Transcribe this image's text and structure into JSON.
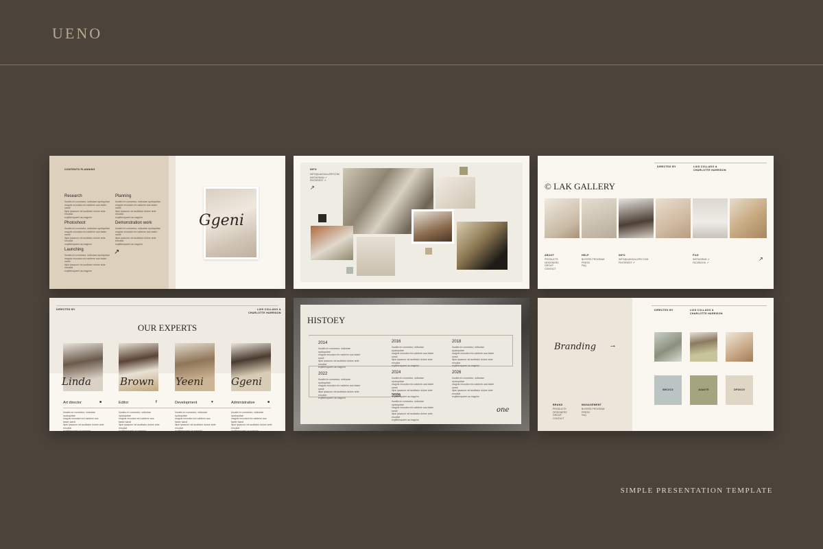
{
  "brand": "UENO",
  "tagline": "SIMPLE PRESENTATION TEMPLATE",
  "lorem": "Iluvalis im consectur, sidiuctae spoloquitae\nmagnis recustan etu vakterm aus faster sandi\nIlipsi ipsacum vel auditatur dolore ante errudtat\nexplitienqueet ua magnim",
  "slide1": {
    "header": "CONTENTS PLANNING",
    "items": [
      {
        "title": "Research"
      },
      {
        "title": "Planning"
      },
      {
        "title": "Photoshoot"
      },
      {
        "title": "Demonstration work"
      },
      {
        "title": "Launching"
      }
    ],
    "script": "Ggeni"
  },
  "slide2": {
    "info_label": "INFO",
    "info_lines": [
      "INFO@LAKGALLERYCOM",
      "INSTAGRAM ↗",
      "PINTEREST ↗"
    ]
  },
  "slide3": {
    "directed_by": "DIRECTED BY",
    "names": "LUIS COLLADO &\nCHARLOTTE HARRISON",
    "title": "© LAK GALLERY",
    "footer": [
      {
        "label": "ABOUT",
        "lines": "PRODUCTS\nDESIGNERS\nGROUP\nCONTACT"
      },
      {
        "label": "HELP",
        "lines": "BUYERS PROGRAM\nPRESS\nFAQ"
      },
      {
        "label": "INFO",
        "lines": "INFO@LAKGALLERY.COM\nPINTEREST ↗"
      },
      {
        "label": "FILE",
        "lines": "INSTAGRAM ↗\nFACEBOOK ↗"
      }
    ]
  },
  "slide4": {
    "directed_by": "DIRECTED BY",
    "names": "LUIS COLLADO &\nCHARLOTTE HARRISON",
    "title": "OUR EXPERTS",
    "experts": [
      {
        "script": "Linda",
        "role": "Art director"
      },
      {
        "script": "Brown",
        "role": "Editor"
      },
      {
        "script": "Yeeni",
        "role": "Development"
      },
      {
        "script": "Ggeni",
        "role": "Administrative"
      }
    ]
  },
  "slide5": {
    "title": "HISTOEY",
    "years": [
      "2014",
      "2016",
      "2018",
      "2022",
      "2024",
      "2026",
      "2028"
    ],
    "script": "one"
  },
  "slide6": {
    "directed_by": "DIRECTED BY",
    "names": "LUIS COLLADO &\nCHARLOTTE HARRISON",
    "script": "Branding",
    "swatches": [
      {
        "label": "B9C4C3",
        "color": "#b9c4c3"
      },
      {
        "label": "A4A47E",
        "color": "#a4a47e"
      },
      {
        "label": "DFD6C5",
        "color": "#dfd6c5"
      }
    ],
    "footer": [
      {
        "label": "BRAND",
        "lines": "PRODUCTS\nDESIGNERS\nGROUP\nCONTACT"
      },
      {
        "label": "MANAGEMENT",
        "lines": "BUYERS PROGRAM\nPRESS\nFAQ"
      }
    ]
  },
  "colors": {
    "background": "#4c443b",
    "slide": "#faf7f1",
    "beige": "#ddd0bd",
    "accent_text": "#b7aa95"
  }
}
